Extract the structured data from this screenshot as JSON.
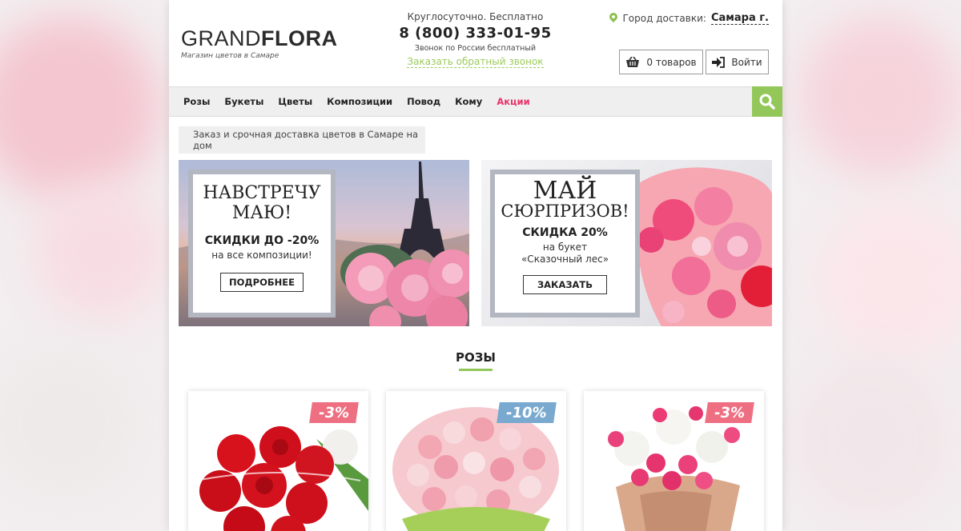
{
  "logo": {
    "part1": "GRAND",
    "part2": "FLORA",
    "tagline": "Магазин цветов в Самаре"
  },
  "contact": {
    "hours": "Круглосуточно. Бесплатно",
    "phone": "8 (800) 333-01-95",
    "note": "Звонок по России бесплатный",
    "callback": "Заказать обратный звонок"
  },
  "city": {
    "label": "Город доставки:",
    "value": "Самара г."
  },
  "header_buttons": {
    "cart": "0 товаров",
    "login": "Войти"
  },
  "nav": {
    "items": [
      "Розы",
      "Букеты",
      "Цветы",
      "Композиции",
      "Повод",
      "Кому",
      "Акции"
    ]
  },
  "breadcrumb": "Заказ и срочная доставка цветов в Самаре на дом",
  "banners": [
    {
      "title_line1": "НАВСТРЕЧУ",
      "title_line2": "МАЮ!",
      "discount": "СКИДКИ ДО -20%",
      "sub": "на все композиции!",
      "button": "ПОДРОБНЕЕ"
    },
    {
      "title_line1": "МАЙ",
      "title_line2": "СЮРПРИЗОВ!",
      "discount": "СКИДКА 20%",
      "sub1": "на букет",
      "sub2": "«Сказочный лес»",
      "button": "ЗАКАЗАТЬ"
    }
  ],
  "section": {
    "title": "РОЗЫ"
  },
  "products": [
    {
      "badge": "-3%",
      "badge_color": "#ee6f82"
    },
    {
      "badge": "-10%",
      "badge_color": "#79a9cf"
    },
    {
      "badge": "-3%",
      "badge_color": "#ee6f82"
    }
  ],
  "colors": {
    "accent_green": "#93c75a",
    "sale_pink": "#e8356b"
  },
  "icons": {
    "pin": "map-pin-icon",
    "cart": "basket-icon",
    "login": "login-arrow-icon",
    "search": "search-icon"
  }
}
